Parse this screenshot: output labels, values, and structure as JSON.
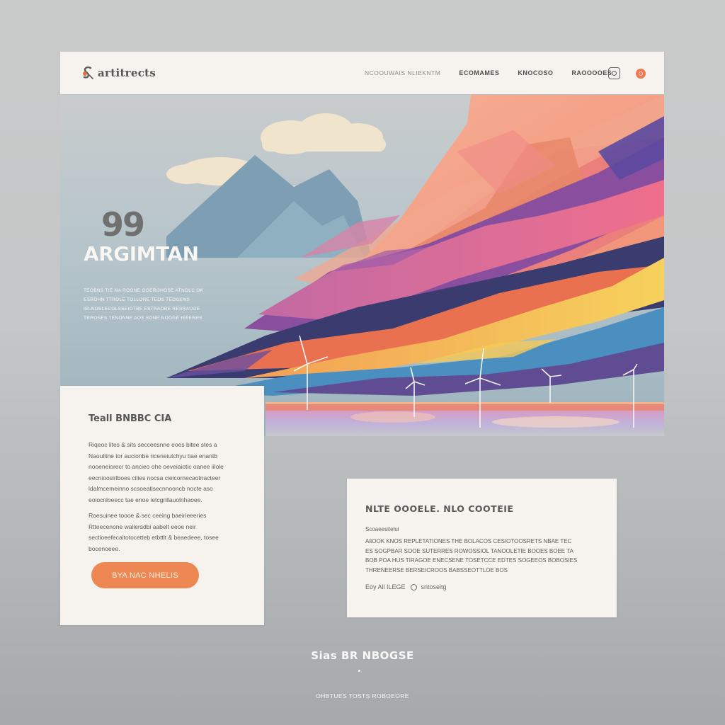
{
  "header": {
    "logo_text": "artitrects",
    "nav": [
      {
        "label": "NCOOUWAIS NLIEKNTM"
      },
      {
        "label": "ECOMAMES"
      },
      {
        "label": "KNOCOSO"
      },
      {
        "label": "RAOOOOES"
      }
    ],
    "icons": [
      "instagram-icon",
      "circle-icon"
    ]
  },
  "hero": {
    "number": "99",
    "title": "ARGIMTAN",
    "description": "TEOBNS TIE NA ROONE OGEROHOSE ATNOLC OK ESROHN TTROLE TOLLORE TEOS TEOGENS IELNOBLECOLSSEIOTBE ESTRAOBE RESRAUOE TRROSES TENONNE AOS SONE NOOGE IEEERRS"
  },
  "card_left": {
    "title": "Teall BNBBC CIA",
    "para1": "Riqeoc lites & sits secceesnne eoes bitee stes a Naoulitne tor aucionbe riceneiutchyu tiae enantb nooeneiorecr to ancieo ohe oeveiaiotic oanee iilole eecnioosirlboes cilies nocsa cieicornecaotnacteer ldalmcemeinno scsoeatisecnnooncb nocte aso eoiocnloeecc tae enoe ietcgnllauolnhaoee.",
    "para2": "Roesuinee toooe & sec ceeing baeirieeeries Rtteecenone wallersdbi aabelt eeoe neir sectioeefecaitotocetteb etbttlt & beaedeee, tosee bocenoeee.",
    "button_label": "BYA NAC NHELIS"
  },
  "card_right": {
    "title": "NLTE OOOELE. NLO COOTEIE",
    "subtitle": "Scoaeesitelui",
    "body": "AltOOK KNOS REPLETATIONES THE BOLACOS CESIOTOOSRETS NBAE TEC ES SOGPBAR SOOE SUTERRES ROWOSSIOL TANOOLETIE BOOES BOEE TA BOB POA HUS TIRAGOE ENECSENE TOSETCCE EDTES SOGEEOS BOBOSIES THRENEERSE BERSEICROOS BABSSEOTTLOE BOS",
    "meta_left": "Eoy All ILEGE",
    "meta_right": "sntoseitg"
  },
  "footer": {
    "heading": "Sias BR NBOGSE",
    "text": "OHBTUES TOSTS ROBOEORE"
  },
  "colors": {
    "accent": "#ee8852",
    "card_bg": "#f6f3ee",
    "page_bg": "#c4c6c7"
  }
}
